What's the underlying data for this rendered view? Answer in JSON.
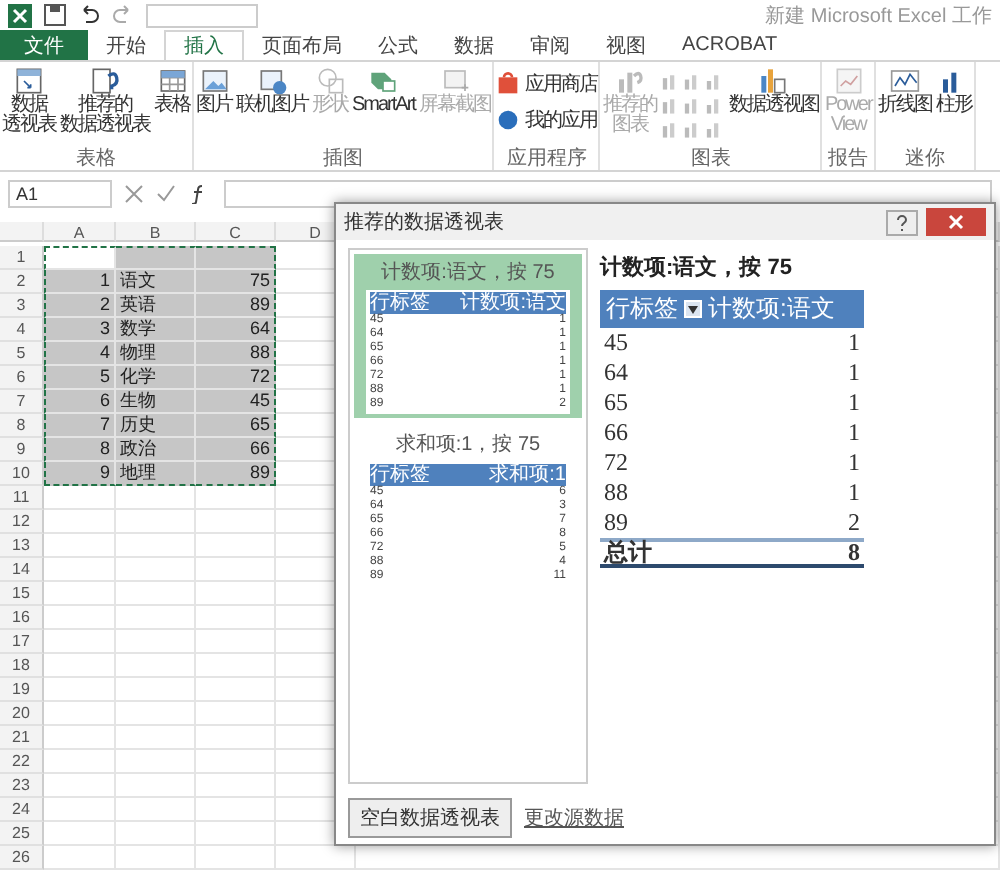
{
  "window": {
    "title": "新建 Microsoft Excel 工作"
  },
  "menu_tabs": [
    {
      "label": "文件",
      "kind": "file",
      "selected": false
    },
    {
      "label": "开始",
      "kind": "tab",
      "selected": false
    },
    {
      "label": "插入",
      "kind": "tab",
      "selected": true
    },
    {
      "label": "页面布局",
      "kind": "tab",
      "selected": false
    },
    {
      "label": "公式",
      "kind": "tab",
      "selected": false
    },
    {
      "label": "数据",
      "kind": "tab",
      "selected": false
    },
    {
      "label": "审阅",
      "kind": "tab",
      "selected": false
    },
    {
      "label": "视图",
      "kind": "tab",
      "selected": false
    },
    {
      "label": "ACROBAT",
      "kind": "tab",
      "selected": false
    }
  ],
  "ribbon_groups": [
    {
      "label": "表格",
      "buttons": [
        {
          "kind": "large",
          "lines": [
            "数据",
            "透视表"
          ],
          "disabled": false
        },
        {
          "kind": "large",
          "lines": [
            "推荐的",
            "数据透视表"
          ],
          "disabled": false
        },
        {
          "kind": "large",
          "lines": [
            "表格"
          ],
          "disabled": false
        }
      ]
    },
    {
      "label": "插图",
      "buttons": [
        {
          "kind": "large",
          "lines": [
            "图片"
          ],
          "disabled": false
        },
        {
          "kind": "large",
          "lines": [
            "联机图片"
          ],
          "disabled": false
        },
        {
          "kind": "large",
          "lines": [
            "形状"
          ],
          "disabled": true
        },
        {
          "kind": "large",
          "lines": [
            "SmartArt"
          ],
          "disabled": false
        },
        {
          "kind": "large",
          "lines": [
            "屏幕截图"
          ],
          "disabled": true
        }
      ]
    },
    {
      "label": "应用程序",
      "buttons": [
        {
          "kind": "small",
          "lines": [
            "应用商店"
          ],
          "disabled": false
        },
        {
          "kind": "small",
          "lines": [
            "我的应用"
          ],
          "disabled": false
        }
      ]
    },
    {
      "label": "图表",
      "buttons": [
        {
          "kind": "large",
          "lines": [
            "推荐的",
            "图表"
          ],
          "disabled": true
        },
        {
          "kind": "gallery",
          "disabled": true
        },
        {
          "kind": "large",
          "lines": [
            "数据透视图"
          ],
          "disabled": false
        }
      ]
    },
    {
      "label": "报告",
      "buttons": [
        {
          "kind": "large",
          "lines": [
            "Power",
            "View"
          ],
          "disabled": true
        }
      ]
    },
    {
      "label": "迷你",
      "buttons": [
        {
          "kind": "large",
          "lines": [
            "折线图"
          ],
          "disabled": false
        },
        {
          "kind": "large",
          "lines": [
            "柱形"
          ],
          "disabled": false
        }
      ]
    }
  ],
  "formula_bar": {
    "name_box": "A1"
  },
  "sheet": {
    "columns": [
      "A",
      "B",
      "C",
      "D"
    ],
    "rows": [
      {
        "number": "1",
        "selected": true,
        "cells": []
      },
      {
        "number": "2",
        "selected": true,
        "cells": [
          "1",
          "语文",
          "75"
        ]
      },
      {
        "number": "3",
        "selected": true,
        "cells": [
          "2",
          "英语",
          "89"
        ]
      },
      {
        "number": "4",
        "selected": true,
        "cells": [
          "3",
          "数学",
          "64"
        ]
      },
      {
        "number": "5",
        "selected": true,
        "cells": [
          "4",
          "物理",
          "88"
        ]
      },
      {
        "number": "6",
        "selected": true,
        "cells": [
          "5",
          "化学",
          "72"
        ]
      },
      {
        "number": "7",
        "selected": true,
        "cells": [
          "6",
          "生物",
          "45"
        ]
      },
      {
        "number": "8",
        "selected": true,
        "cells": [
          "7",
          "历史",
          "65"
        ]
      },
      {
        "number": "9",
        "selected": true,
        "cells": [
          "8",
          "政治",
          "66"
        ]
      },
      {
        "number": "10",
        "selected": true,
        "cells": [
          "9",
          "地理",
          "89"
        ]
      },
      {
        "number": "11",
        "selected": false,
        "cells": []
      },
      {
        "number": "12",
        "selected": false,
        "cells": []
      },
      {
        "number": "13",
        "selected": false,
        "cells": []
      },
      {
        "number": "14",
        "selected": false,
        "cells": []
      },
      {
        "number": "15",
        "selected": false,
        "cells": []
      },
      {
        "number": "16",
        "selected": false,
        "cells": []
      },
      {
        "number": "17",
        "selected": false,
        "cells": []
      },
      {
        "number": "18",
        "selected": false,
        "cells": []
      },
      {
        "number": "19",
        "selected": false,
        "cells": []
      },
      {
        "number": "20",
        "selected": false,
        "cells": []
      },
      {
        "number": "21",
        "selected": false,
        "cells": []
      },
      {
        "number": "22",
        "selected": false,
        "cells": []
      },
      {
        "number": "23",
        "selected": false,
        "cells": []
      },
      {
        "number": "24",
        "selected": false,
        "cells": []
      },
      {
        "number": "25",
        "selected": false,
        "cells": []
      },
      {
        "number": "26",
        "selected": false,
        "cells": []
      }
    ]
  },
  "dialog": {
    "title": "推荐的数据透视表",
    "thumbnails": [
      {
        "title": "计数项:语文，按 75",
        "selected": true,
        "header": [
          "行标签",
          "计数项:语文"
        ],
        "rows": [
          [
            "45",
            "1"
          ],
          [
            "64",
            "1"
          ],
          [
            "65",
            "1"
          ],
          [
            "66",
            "1"
          ],
          [
            "72",
            "1"
          ],
          [
            "88",
            "1"
          ],
          [
            "89",
            "2"
          ]
        ]
      },
      {
        "title": "求和项:1，按 75",
        "selected": false,
        "header": [
          "行标签",
          "求和项:1"
        ],
        "rows": [
          [
            "45",
            "6"
          ],
          [
            "64",
            "3"
          ],
          [
            "65",
            "7"
          ],
          [
            "66",
            "8"
          ],
          [
            "72",
            "5"
          ],
          [
            "88",
            "4"
          ],
          [
            "89",
            "11"
          ]
        ]
      }
    ],
    "preview": {
      "title": "计数项:语文，按 75",
      "header": [
        "行标签",
        "计数项:语文"
      ],
      "rows": [
        [
          "45",
          "1"
        ],
        [
          "64",
          "1"
        ],
        [
          "65",
          "1"
        ],
        [
          "66",
          "1"
        ],
        [
          "72",
          "1"
        ],
        [
          "88",
          "1"
        ],
        [
          "89",
          "2"
        ]
      ],
      "total": [
        "总计",
        "8"
      ]
    },
    "buttons": {
      "blank": "空白数据透视表",
      "change_source": "更改源数据"
    }
  }
}
